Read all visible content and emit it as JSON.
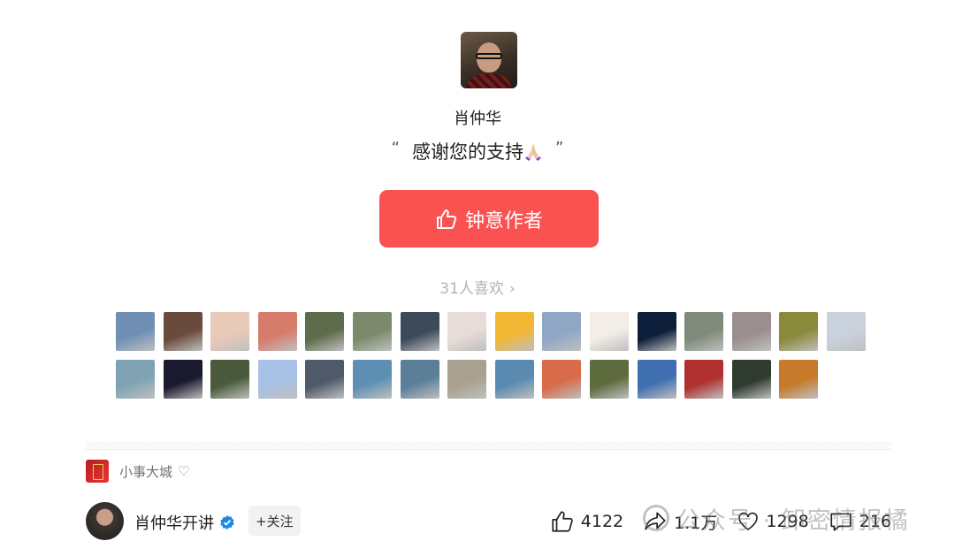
{
  "author": {
    "name": "肖仲华",
    "quote": "感谢您的支持",
    "quote_open": "“",
    "quote_close": "”"
  },
  "like_button": {
    "label": "钟意作者",
    "icon": "thumb-up-icon"
  },
  "fans": {
    "count_label": "31人喜欢",
    "avatars": [
      "#6f8fb5",
      "#6a4a3b",
      "#e9c9b8",
      "#d77b6a",
      "#5d6c4a",
      "#7a8a6a",
      "#3c4a5a",
      "#e7dcd7",
      "#f2b735",
      "#8fa7c4",
      "#f2ede6",
      "#0d1e3a",
      "#7f8a7a",
      "#9a8e8e",
      "#8a8a3a",
      "#c9d2dc",
      "#7fa3b5",
      "#1a1a2e",
      "#4a5a3a",
      "#a8c1e6",
      "#4e5a6a",
      "#5d8fb5",
      "#5b7f98",
      "#a9a190",
      "#5a8ab0",
      "#d86b4a",
      "#5d6b3d",
      "#3f6fb0",
      "#b03030",
      "#2e3b2e",
      "#c67a2a"
    ]
  },
  "collection": {
    "name": "小事大城",
    "icon": "collection-cover-icon"
  },
  "bottom": {
    "author_name": "肖仲华开讲",
    "follow_label": "+关注",
    "likes": "4122",
    "shares": "1.1万",
    "hearts": "1298",
    "comments": "216"
  },
  "watermark": "公众号 · 卸密情报橘",
  "colors": {
    "accent": "#fa5151",
    "verified": "#1e88e5"
  }
}
